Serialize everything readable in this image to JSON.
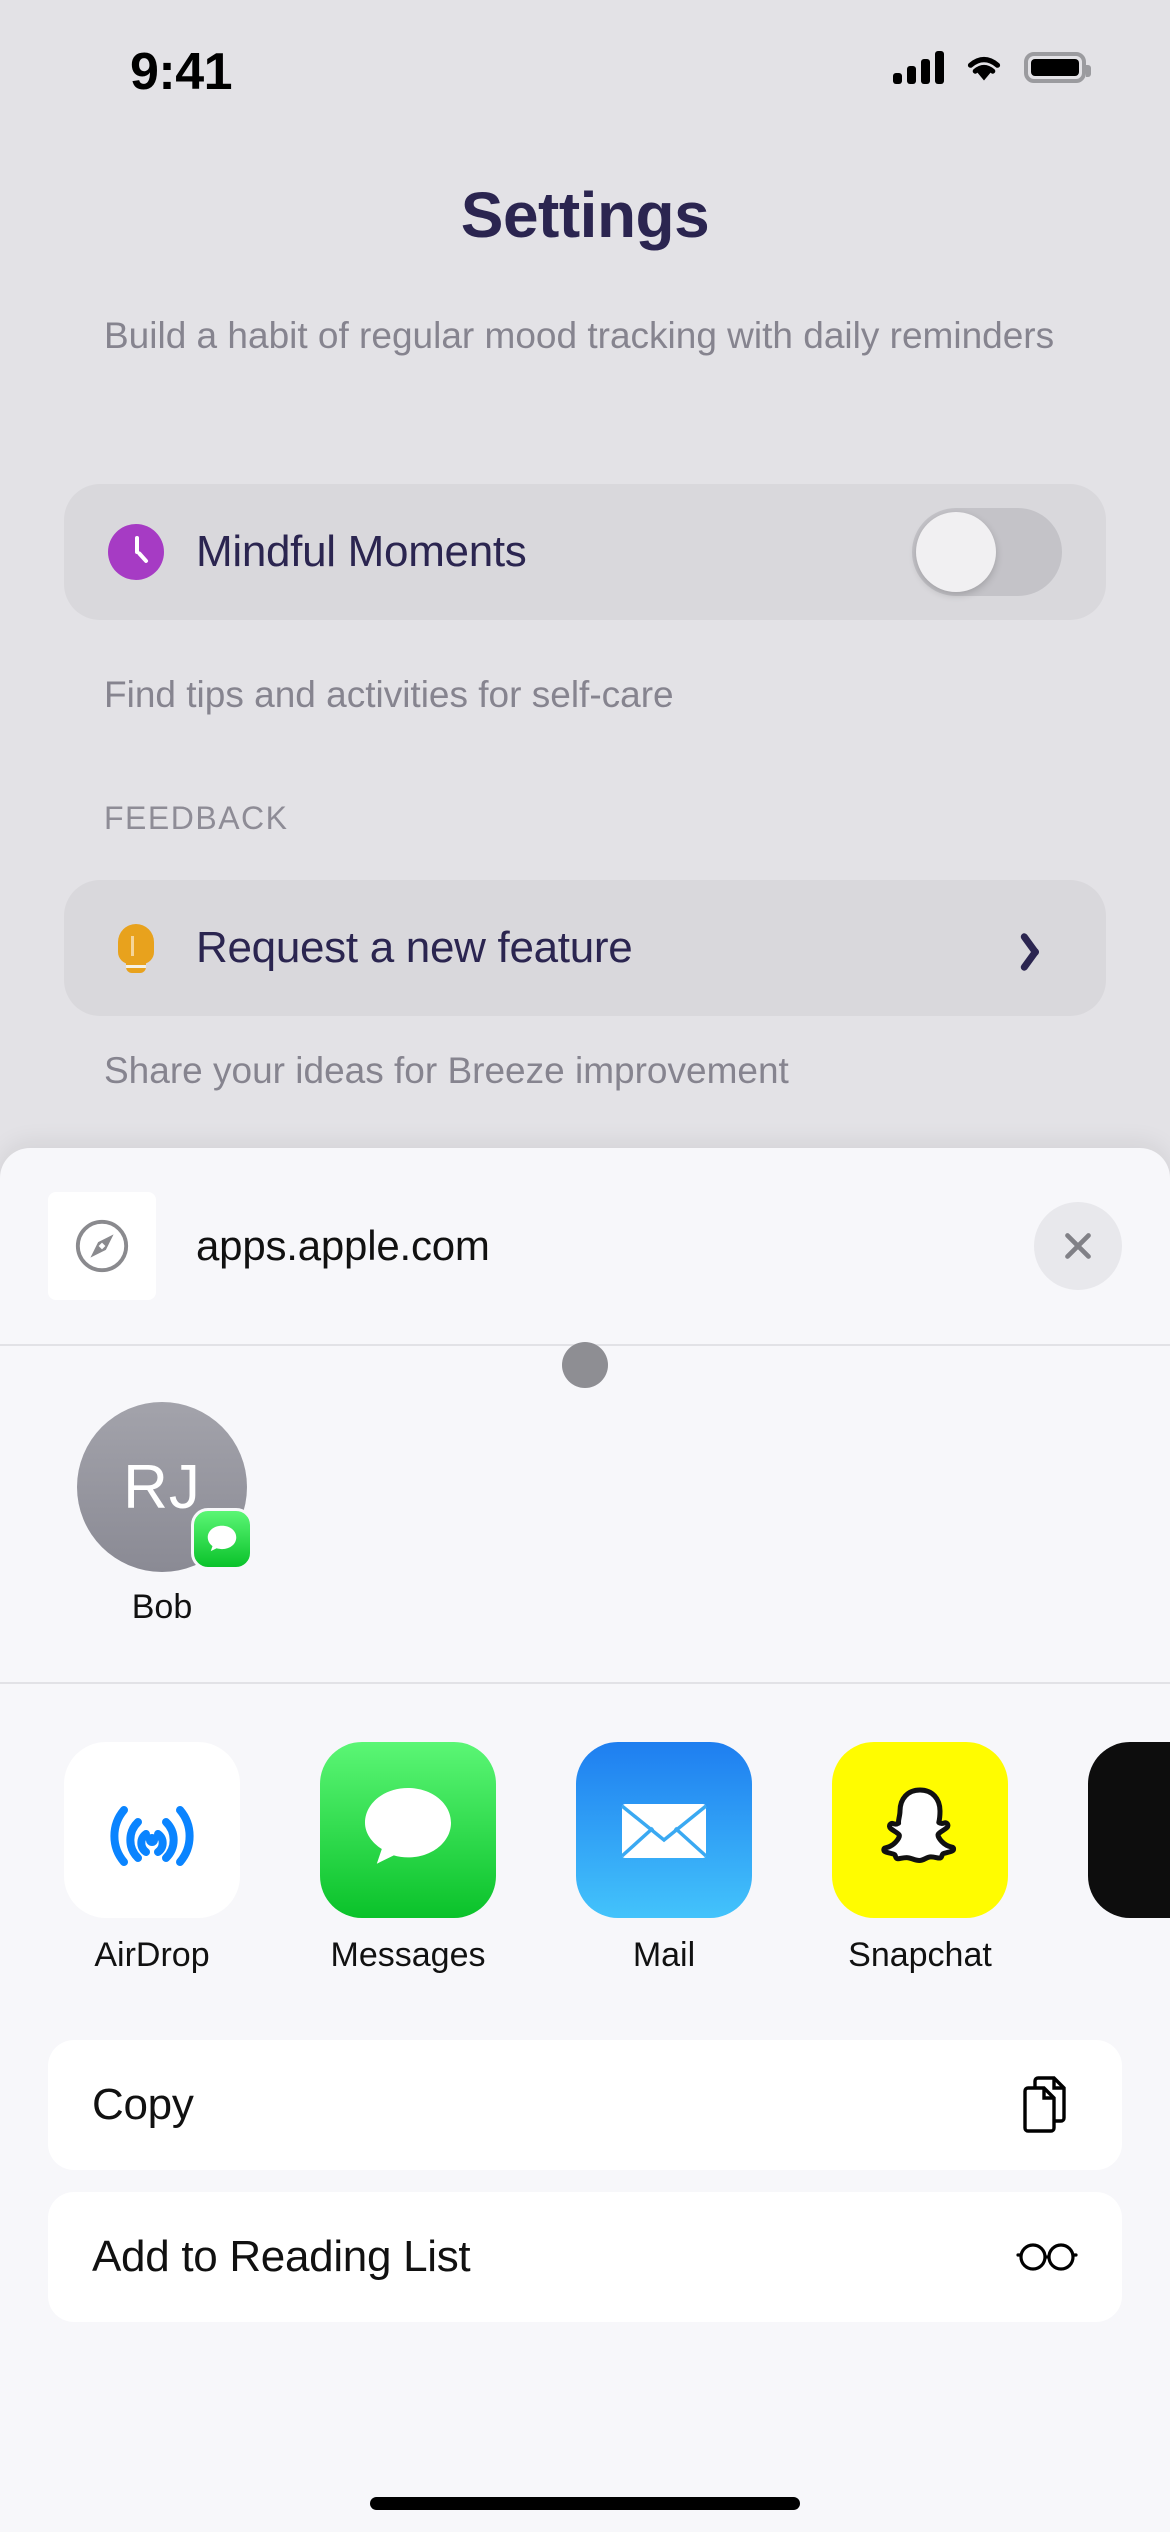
{
  "status_bar": {
    "time": "9:41",
    "signal_icon": "cellular-signal-icon",
    "wifi_icon": "wifi-icon",
    "battery_icon": "battery-icon"
  },
  "settings": {
    "title": "Settings",
    "subtitle": "Build a habit of regular mood tracking with daily reminders",
    "mindful_row": {
      "label": "Mindful Moments",
      "icon": "clock-icon",
      "icon_color": "#a63bc4",
      "toggle_state": "off"
    },
    "mindful_caption": "Find tips and activities for self-care",
    "feedback_section_header": "FEEDBACK",
    "feature_row": {
      "label": "Request a new feature",
      "icon": "lightbulb-icon",
      "icon_color": "#e8a21d",
      "chevron": "chevron-right-icon"
    },
    "feature_caption": "Share your ideas for Breeze improvement"
  },
  "share_sheet": {
    "favicon": "safari-compass-icon",
    "url": "apps.apple.com",
    "close_label": "close-icon",
    "contacts": [
      {
        "initials": "RJ",
        "name": "Bob",
        "badge_app": "messages-icon"
      }
    ],
    "apps": [
      {
        "name": "AirDrop",
        "icon": "airdrop-icon"
      },
      {
        "name": "Messages",
        "icon": "messages-icon"
      },
      {
        "name": "Mail",
        "icon": "mail-icon"
      },
      {
        "name": "Snapchat",
        "icon": "snapchat-icon"
      },
      {
        "name": "",
        "icon": "dark-app-icon"
      }
    ],
    "actions": [
      {
        "label": "Copy",
        "icon": "copy-documents-icon"
      },
      {
        "label": "Add to Reading List",
        "icon": "glasses-icon"
      }
    ]
  },
  "colors": {
    "page_background": "#e3e2e6",
    "card_background": "#d9d8dc",
    "sheet_background": "#f7f7fa",
    "accent_purple": "#a63bc4",
    "accent_orange": "#e8a21d",
    "title_navy": "#2b2550",
    "muted_gray": "#86848f"
  }
}
